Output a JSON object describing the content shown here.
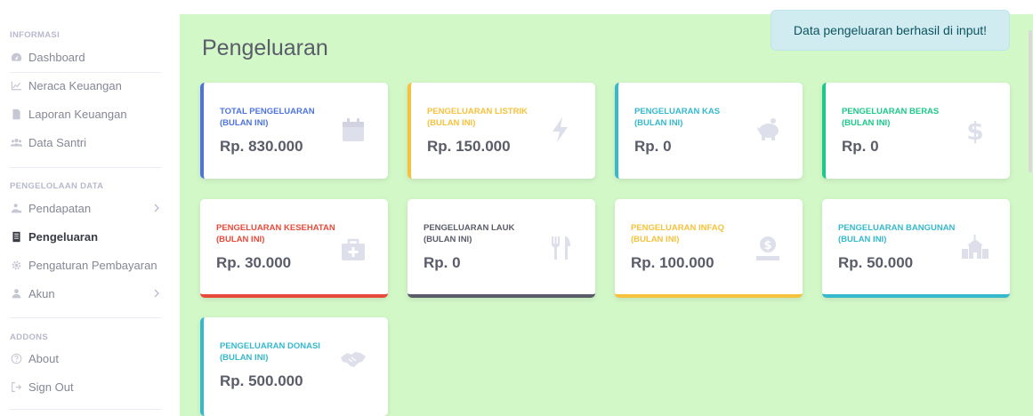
{
  "sidebar": {
    "heading_informasi": "INFORMASI",
    "heading_pengelolaan": "PENGELOLAAN DATA",
    "heading_addons": "ADDONS",
    "items": [
      {
        "label": "Dashboard",
        "icon": "dashboard-icon"
      },
      {
        "label": "Neraca Keuangan",
        "icon": "chart-line-icon"
      },
      {
        "label": "Laporan Keuangan",
        "icon": "file-icon"
      },
      {
        "label": "Data Santri",
        "icon": "users-icon"
      },
      {
        "label": "Pendapatan",
        "icon": "user-income-icon"
      },
      {
        "label": "Pengeluaran",
        "icon": "list-icon"
      },
      {
        "label": "Pengaturan Pembayaran",
        "icon": "gear-icon"
      },
      {
        "label": "Akun",
        "icon": "user-icon"
      },
      {
        "label": "About",
        "icon": "question-circle-icon"
      },
      {
        "label": "Sign Out",
        "icon": "sign-out-icon"
      }
    ]
  },
  "main": {
    "title": "Pengeluaran",
    "toast": "Data pengeluaran berhasil di input!",
    "cards": [
      {
        "label": "TOTAL PENGELUARAN (BULAN INI)",
        "value": "Rp. 830.000",
        "color": "#4e73df",
        "icon": "calendar-icon"
      },
      {
        "label": "PENGELUARAN LISTRIK (BULAN INI)",
        "value": "Rp. 150.000",
        "color": "#f6c23e",
        "icon": "bolt-icon"
      },
      {
        "label": "PENGELUARAN KAS (BULAN INI)",
        "value": "Rp. 0",
        "color": "#36b9cc",
        "icon": "piggy-bank-icon"
      },
      {
        "label": "PENGELUARAN BERAS (BULAN INI)",
        "value": "Rp. 0",
        "color": "#1cc88a",
        "icon": "dollar-icon"
      },
      {
        "label": "PENGELUARAN KESEHATAN (BULAN INI)",
        "value": "Rp. 30.000",
        "color": "#e74a3b",
        "icon": "medkit-icon"
      },
      {
        "label": "PENGELUARAN LAUK (BULAN INI)",
        "value": "Rp. 0",
        "color": "#5a5c69",
        "icon": "utensils-icon"
      },
      {
        "label": "PENGELUARAN INFAQ (BULAN INI)",
        "value": "Rp. 100.000",
        "color": "#f6c23e",
        "icon": "coin-hand-icon"
      },
      {
        "label": "PENGELUARAN BANGUNAN (BULAN INI)",
        "value": "Rp. 50.000",
        "color": "#36b9cc",
        "icon": "school-icon"
      },
      {
        "label": "PENGELUARAN DONASI (BULAN INI)",
        "value": "Rp. 500.000",
        "color": "#36b9cc",
        "icon": "handshake-icon"
      }
    ]
  }
}
